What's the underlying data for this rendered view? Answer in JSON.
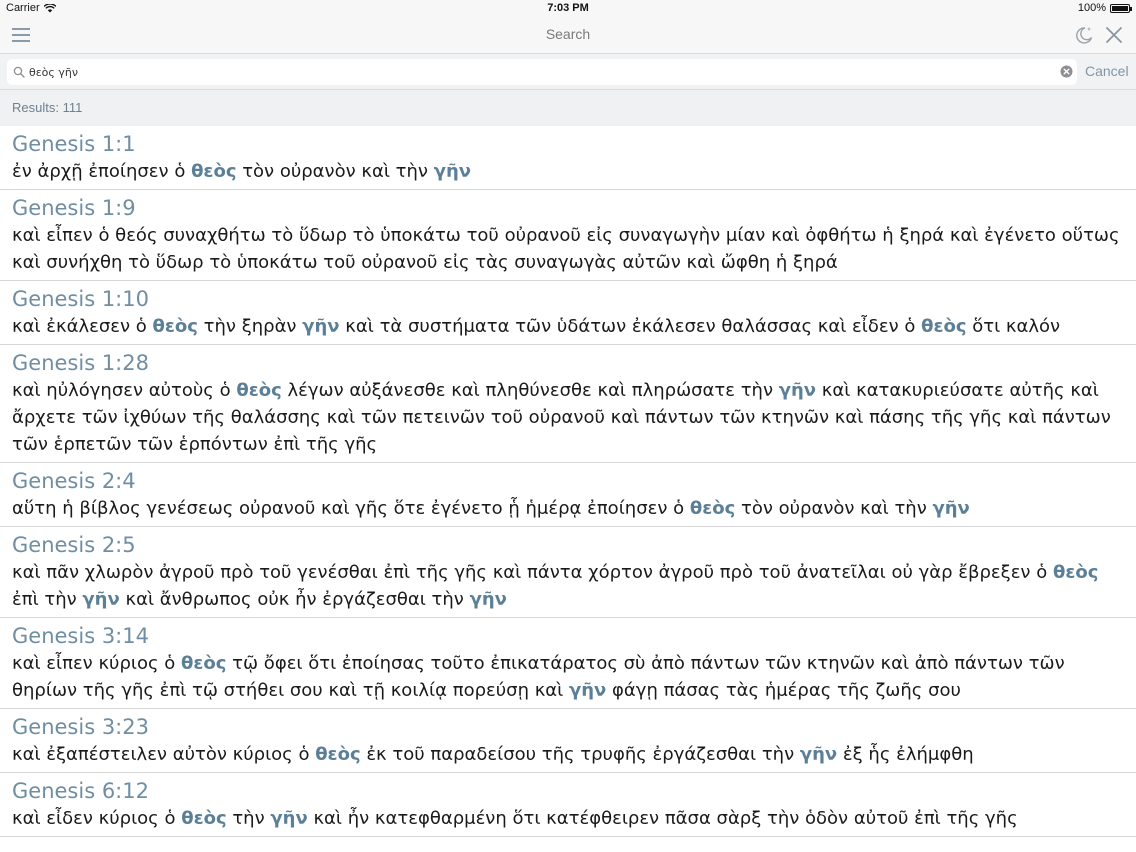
{
  "status_bar": {
    "carrier": "Carrier",
    "time": "7:03 PM",
    "battery": "100%",
    "battery_level": 1.0
  },
  "nav": {
    "title": "Search",
    "left_icon": "menu-icon",
    "right_icons": [
      "night-mode-icon",
      "close-icon"
    ]
  },
  "search": {
    "value": "θεὸς γῆν",
    "cancel_label": "Cancel"
  },
  "results_label": "Results: 111",
  "colors": {
    "accent": "#5b7f97",
    "reference": "#6f8ea3",
    "bar_bg": "#f7f7f7"
  },
  "results": [
    {
      "ref": "Genesis 1:1",
      "segments": [
        "ἐν ἀρχῇ ἐποίησεν ὁ ",
        {
          "hl": "θεὸς"
        },
        " τὸν οὐρανὸν καὶ τὴν ",
        {
          "hl": "γῆν"
        }
      ]
    },
    {
      "ref": "Genesis 1:9",
      "segments": [
        "καὶ εἶπεν ὁ θεός συναχθήτω τὸ ὕδωρ τὸ ὑποκάτω τοῦ οὐρανοῦ εἰς συναγωγὴν μίαν καὶ ὀφθήτω ἡ ξηρά καὶ ἐγένετο οὕτως καὶ συνήχθη τὸ ὕδωρ τὸ ὑποκάτω τοῦ οὐρανοῦ εἰς τὰς συναγωγὰς αὐτῶν καὶ ὤφθη ἡ ξηρά"
      ]
    },
    {
      "ref": "Genesis 1:10",
      "segments": [
        "καὶ ἐκάλεσεν ὁ ",
        {
          "hl": "θεὸς"
        },
        " τὴν ξηρὰν ",
        {
          "hl": "γῆν"
        },
        " καὶ τὰ συστήματα τῶν ὑδάτων ἐκάλεσεν θαλάσσας καὶ εἶδεν ὁ ",
        {
          "hl": "θεὸς"
        },
        " ὅτι καλόν"
      ]
    },
    {
      "ref": "Genesis 1:28",
      "segments": [
        "καὶ ηὐλόγησεν αὐτοὺς ὁ ",
        {
          "hl": "θεὸς"
        },
        " λέγων αὐξάνεσθε καὶ πληθύνεσθε καὶ πληρώσατε τὴν ",
        {
          "hl": "γῆν"
        },
        " καὶ κατακυριεύσατε αὐτῆς καὶ ἄρχετε τῶν ἰχθύων τῆς θαλάσσης καὶ τῶν πετεινῶν τοῦ οὐρανοῦ καὶ πάντων τῶν κτηνῶν καὶ πάσης τῆς γῆς καὶ πάντων τῶν ἑρπετῶν τῶν ἑρπόντων ἐπὶ τῆς γῆς"
      ]
    },
    {
      "ref": "Genesis 2:4",
      "segments": [
        "αὕτη ἡ βίβλος γενέσεως οὐρανοῦ καὶ γῆς ὅτε ἐγένετο ᾗ ἡμέρᾳ ἐποίησεν ὁ ",
        {
          "hl": "θεὸς"
        },
        " τὸν οὐρανὸν καὶ τὴν ",
        {
          "hl": "γῆν"
        }
      ]
    },
    {
      "ref": "Genesis 2:5",
      "segments": [
        "καὶ πᾶν χλωρὸν ἀγροῦ πρὸ τοῦ γενέσθαι ἐπὶ τῆς γῆς καὶ πάντα χόρτον ἀγροῦ πρὸ τοῦ ἀνατεῖλαι οὐ γὰρ ἔβρεξεν ὁ ",
        {
          "hl": "θεὸς"
        },
        " ἐπὶ τὴν ",
        {
          "hl": "γῆν"
        },
        " καὶ ἄνθρωπος οὐκ ἦν ἐργάζεσθαι τὴν ",
        {
          "hl": "γῆν"
        }
      ]
    },
    {
      "ref": "Genesis 3:14",
      "segments": [
        "καὶ εἶπεν κύριος ὁ ",
        {
          "hl": "θεὸς"
        },
        " τῷ ὄφει ὅτι ἐποίησας τοῦτο ἐπικατάρατος σὺ ἀπὸ πάντων τῶν κτηνῶν καὶ ἀπὸ πάντων τῶν θηρίων τῆς γῆς ἐπὶ τῷ στήθει σου καὶ τῇ κοιλίᾳ πορεύσῃ καὶ ",
        {
          "hl": "γῆν"
        },
        " φάγῃ πάσας τὰς ἡμέρας τῆς ζωῆς σου"
      ]
    },
    {
      "ref": "Genesis 3:23",
      "segments": [
        "καὶ ἐξαπέστειλεν αὐτὸν κύριος ὁ ",
        {
          "hl": "θεὸς"
        },
        " ἐκ τοῦ παραδείσου τῆς τρυφῆς ἐργάζεσθαι τὴν ",
        {
          "hl": "γῆν"
        },
        " ἐξ ἧς ἐλήμφθη"
      ]
    },
    {
      "ref": "Genesis 6:12",
      "segments": [
        "καὶ εἶδεν κύριος ὁ ",
        {
          "hl": "θεὸς"
        },
        " τὴν ",
        {
          "hl": "γῆν"
        },
        " καὶ ἦν κατεφθαρμένη ὅτι κατέφθειρεν πᾶσα σὰρξ τὴν ὁδὸν αὐτοῦ ἐπὶ τῆς γῆς"
      ]
    }
  ]
}
